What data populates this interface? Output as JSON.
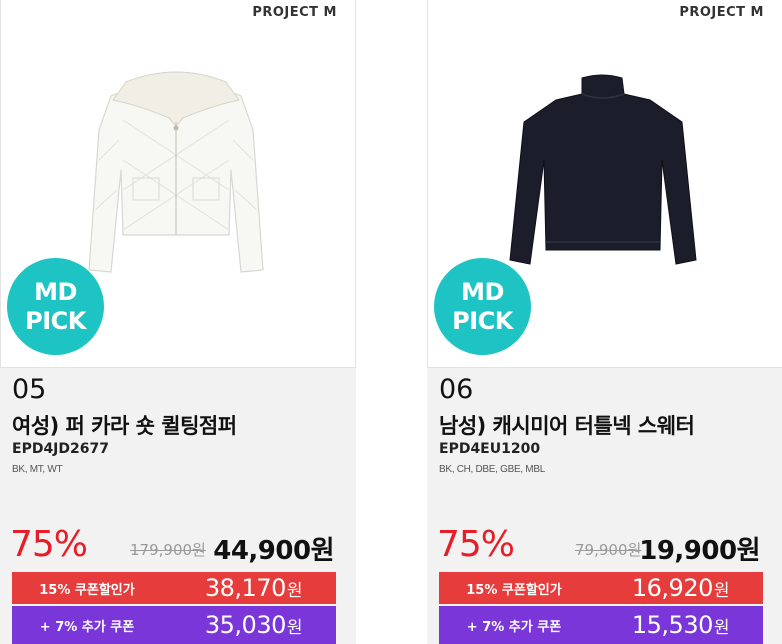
{
  "colors": {
    "accent_red": "#e61e28",
    "coupon_red": "#e63c3c",
    "coupon_purple": "#7a36d8",
    "md_pick_teal": "#1ec4c3"
  },
  "products": [
    {
      "brand": "PROJECT M",
      "badge_line1": "MD",
      "badge_line2": "PICK",
      "number": "05",
      "title": "여성) 퍼 카라 숏 퀼팅점퍼",
      "code": "EPD4JD2677",
      "color_options": "BK, MT, WT",
      "discount_pct": "75%",
      "original_price": "179,900원",
      "final_price": "44,900원",
      "coupon_label": "15% 쿠폰할인가",
      "coupon_price": "38,170",
      "coupon_unit": "원",
      "extra_label": "+ 7% 추가 쿠폰",
      "extra_price": "35,030",
      "extra_unit": "원",
      "image_icon": "quilted-jacket-icon"
    },
    {
      "brand": "PROJECT M",
      "badge_line1": "MD",
      "badge_line2": "PICK",
      "number": "06",
      "title": "남성) 캐시미어 터틀넥 스웨터",
      "code": "EPD4EU1200",
      "color_options": "BK, CH, DBE, GBE, MBL",
      "discount_pct": "75%",
      "original_price": "79,900원",
      "final_price": "19,900원",
      "coupon_label": "15% 쿠폰할인가",
      "coupon_price": "16,920",
      "coupon_unit": "원",
      "extra_label": "+ 7% 추가 쿠폰",
      "extra_price": "15,530",
      "extra_unit": "원",
      "image_icon": "turtleneck-sweater-icon"
    }
  ]
}
